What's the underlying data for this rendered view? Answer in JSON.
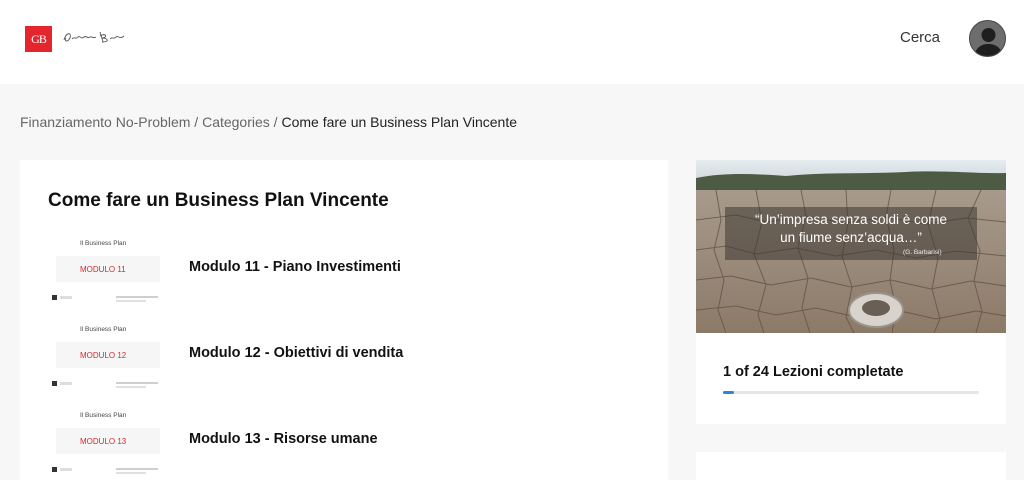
{
  "header": {
    "logo_text": "GB",
    "search_label": "Cerca"
  },
  "breadcrumb": {
    "items": [
      "Finanziamento No-Problem",
      "Categories"
    ],
    "separator": "/",
    "current": "Come fare un Business Plan Vincente"
  },
  "course": {
    "title": "Come fare un Business Plan Vincente",
    "lessons": [
      {
        "thumb_header": "Il Business Plan",
        "thumb_module": "MODULO 11",
        "title": "Modulo 11 - Piano Investimenti"
      },
      {
        "thumb_header": "Il Business Plan",
        "thumb_module": "MODULO 12",
        "title": "Modulo 12 - Obiettivi di vendita"
      },
      {
        "thumb_header": "Il Business Plan",
        "thumb_module": "MODULO 13",
        "title": "Modulo 13 - Risorse umane"
      }
    ]
  },
  "sidebar": {
    "quote_line1": "“Un’impresa senza soldi è come",
    "quote_line2": "un fiume senz’acqua…”",
    "quote_author": "(G. Barbarisi)",
    "progress_label": "1 of 24 Lezioni completate",
    "progress_fraction": 0.042
  },
  "colors": {
    "brand_red": "#e4262c",
    "progress_blue": "#2a87d8"
  }
}
